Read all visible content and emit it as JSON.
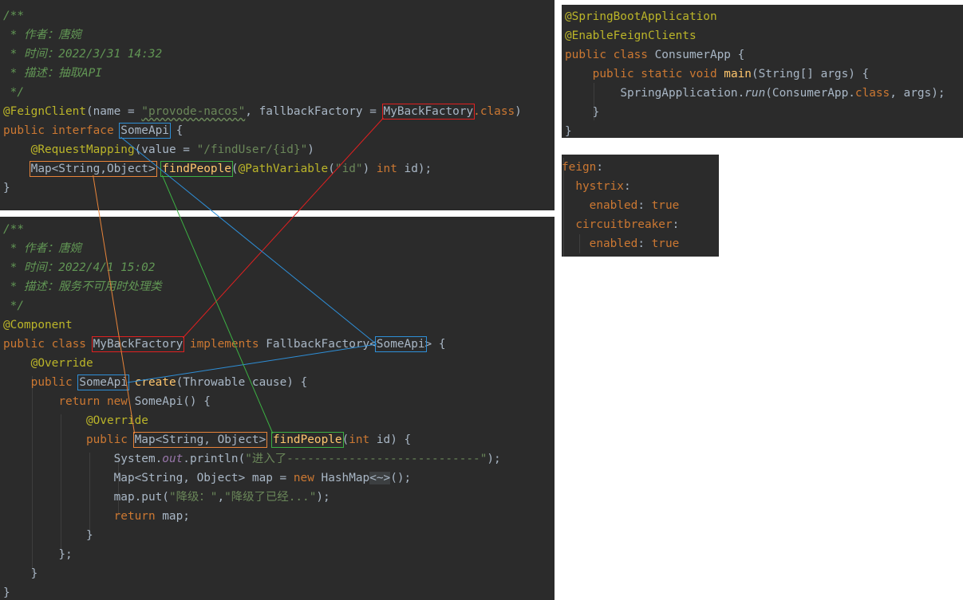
{
  "interface_panel": {
    "comment_open": "/**",
    "comment_author": " * 作者：唐婉",
    "comment_time": " * 时间：2022/3/31 14:32",
    "comment_desc": " * 描述：抽取API",
    "comment_close": " */",
    "feign_annot": "@FeignClient",
    "feign_args_open": "(name = ",
    "feign_name_value": "\"provode-nacos\"",
    "feign_args_mid": ", fallbackFactory = ",
    "feign_factory": "MyBackFactory",
    "feign_class_suffix": ".class",
    "feign_close": ")",
    "kw_public": "public",
    "kw_interface": " interface ",
    "iface_name": "SomeApi",
    "iface_brace": " {",
    "mapping_annot": "@RequestMapping",
    "mapping_args_open": "(value = ",
    "mapping_path": "\"/findUser/{id}\"",
    "mapping_close": ")",
    "return_type": "Map<String,Object>",
    "method_name": "findPeople",
    "pathvar_open": "(",
    "pathvar_annot": "@PathVariable",
    "pathvar_arg_open": "(",
    "pathvar_value": "\"id\"",
    "pathvar_arg_close": ") ",
    "kw_int": "int",
    "param_end": " id);",
    "close_brace": "}"
  },
  "factory_panel": {
    "comment_open": "/**",
    "comment_author": " * 作者：唐婉",
    "comment_time": " * 时间：2022/4/1 15:02",
    "comment_desc": " * 描述：服务不可用时处理类",
    "comment_close": " */",
    "component_annot": "@Component",
    "kw_public_class": "public class ",
    "class_name": "MyBackFactory",
    "kw_implements": " implements ",
    "fallback_type": "FallbackFactory<",
    "generic_type": "SomeApi",
    "class_open": "> {",
    "override1": "@Override",
    "kw_public": "public ",
    "create_return_type": "SomeApi",
    "create_name": "create",
    "create_params": "(Throwable cause) {",
    "kw_return": "return ",
    "kw_new": "new ",
    "anon_type": "SomeApi() {",
    "override2": "@Override",
    "method_return_type": "Map<String, Object>",
    "method_name": "findPeople",
    "method_params_open": "(",
    "kw_int": "int",
    "method_params_close": " id) {",
    "println_pre": "System.",
    "println_field": "out",
    "println_mid": ".println(",
    "println_str": "\"进入了----------------------------\"",
    "println_end": ");",
    "map_decl": "Map<String, Object> map = ",
    "map_new": "new ",
    "map_type": "HashMap",
    "map_diamond": "<~>",
    "map_end": "();",
    "put_pre": "map.put(",
    "put_key": "\"降级：\"",
    "put_comma": ",",
    "put_value": "\"降级了已经...\"",
    "put_end": ");",
    "return_map": "return map;",
    "return_map_kw": "return",
    "return_map_rest": " map;",
    "inner_close": "}",
    "anon_close": "};",
    "create_close": "}",
    "class_close": "}"
  },
  "app_panel": {
    "annot1": "@SpringBootApplication",
    "annot2": "@EnableFeignClients",
    "kw_public_class": "public class ",
    "class_name": "ConsumerApp {",
    "kw_main": "public static void ",
    "main_name": "main",
    "main_params": "(String[] args) {",
    "run_pre": "SpringApplication.",
    "run_name": "run",
    "run_mid": "(ConsumerApp.",
    "run_class_kw": "class",
    "run_end": ", args);",
    "inner_close": "}",
    "outer_close": "}"
  },
  "yaml_panel": {
    "feign": "feign",
    "hystrix": "hystrix",
    "enabled1": "enabled",
    "value1": "true",
    "circuitbreaker": "circuitbreaker",
    "enabled2": "enabled",
    "value2": "true",
    "colon": ":",
    "colon_space": ": "
  },
  "colors": {
    "editor_bg": "#2b2b2b",
    "link_red": "#e02020",
    "link_blue": "#2e8fd8",
    "link_orange": "#e8843a",
    "link_green": "#3cb043"
  }
}
